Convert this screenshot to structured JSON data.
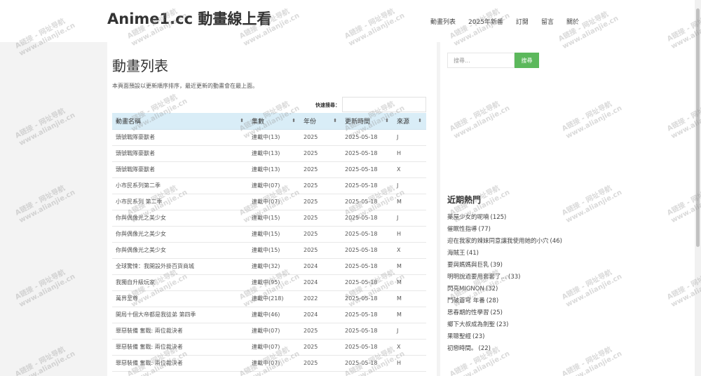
{
  "header": {
    "site_title": "Anime1.cc 動畫線上看",
    "nav": [
      "動畫列表",
      "2025年新番",
      "訂閱",
      "留言",
      "關於"
    ]
  },
  "main": {
    "heading": "動畫列表",
    "intro": "本頁面預設以更新順序排序，最近更新的動畫會在最上面。",
    "search_label": "快速搜尋：",
    "table": {
      "columns": [
        "動畫名稱",
        "集數",
        "年份",
        "更新時間",
        "來源"
      ],
      "rows": [
        [
          "頭號戰隊豪獸者",
          "連載中(13)",
          "2025",
          "2025-05-18",
          "J"
        ],
        [
          "頭號戰隊豪獸者",
          "連載中(13)",
          "2025",
          "2025-05-18",
          "H"
        ],
        [
          "頭號戰隊豪獸者",
          "連載中(13)",
          "2025",
          "2025-05-18",
          "X"
        ],
        [
          "小市民系列第二季",
          "連載中(07)",
          "2025",
          "2025-05-18",
          "J"
        ],
        [
          "小市民系列 第二季",
          "連載中(07)",
          "2025",
          "2025-05-18",
          "M"
        ],
        [
          "你與偶像光之美少女",
          "連載中(15)",
          "2025",
          "2025-05-18",
          "J"
        ],
        [
          "你與偶像光之美少女",
          "連載中(15)",
          "2025",
          "2025-05-18",
          "H"
        ],
        [
          "你與偶像光之美少女",
          "連載中(15)",
          "2025",
          "2025-05-18",
          "X"
        ],
        [
          "全球驚悚：我開設外掛百貨商城",
          "連載中(32)",
          "2024",
          "2025-05-18",
          "M"
        ],
        [
          "我獨自升級玩家",
          "連載中(95)",
          "2024",
          "2025-05-18",
          "M"
        ],
        [
          "萬界至尊",
          "連載中(218)",
          "2022",
          "2025-05-18",
          "M"
        ],
        [
          "開局十個大帝都是我徒弟 第四季",
          "連載中(46)",
          "2024",
          "2025-05-18",
          "M"
        ],
        [
          "罪惡裝備 奮戰: 兩位裁決者",
          "連載中(07)",
          "2025",
          "2025-05-18",
          "J"
        ],
        [
          "罪惡裝備 奮戰: 兩位裁決者",
          "連載中(07)",
          "2025",
          "2025-05-18",
          "X"
        ],
        [
          "罪惡裝備 奮戰: 兩位裁決者",
          "連載中(07)",
          "2025",
          "2025-05-18",
          "H"
        ]
      ]
    }
  },
  "sidebar": {
    "search_placeholder": "搜尋...",
    "search_button": "搜尋",
    "hot_heading": "近期熱門",
    "hot_items": [
      {
        "title": "藥屋少女的呢喃",
        "count": "(125)"
      },
      {
        "title": "催眠性指導",
        "count": "(77)"
      },
      {
        "title": "迎在我家的辣妹同意讓我使用她的小穴",
        "count": "(46)"
      },
      {
        "title": "海賊王",
        "count": "(41)"
      },
      {
        "title": "要與媽媽與巨乳",
        "count": "(39)"
      },
      {
        "title": "明明說過要用套套了…",
        "count": "(33)"
      },
      {
        "title": "閃亮MIGNON",
        "count": "(32)"
      },
      {
        "title": "鬥破蒼穹 年番",
        "count": "(28)"
      },
      {
        "title": "思春期的性學習",
        "count": "(25)"
      },
      {
        "title": "鄉下大叔成為劍聖",
        "count": "(23)"
      },
      {
        "title": "果聰聖經",
        "count": "(23)"
      },
      {
        "title": "初戀時間。",
        "count": "(22)"
      }
    ]
  },
  "watermark": {
    "line1": "A链接 - 网址导航",
    "line2": "www.alianjie.cn"
  }
}
